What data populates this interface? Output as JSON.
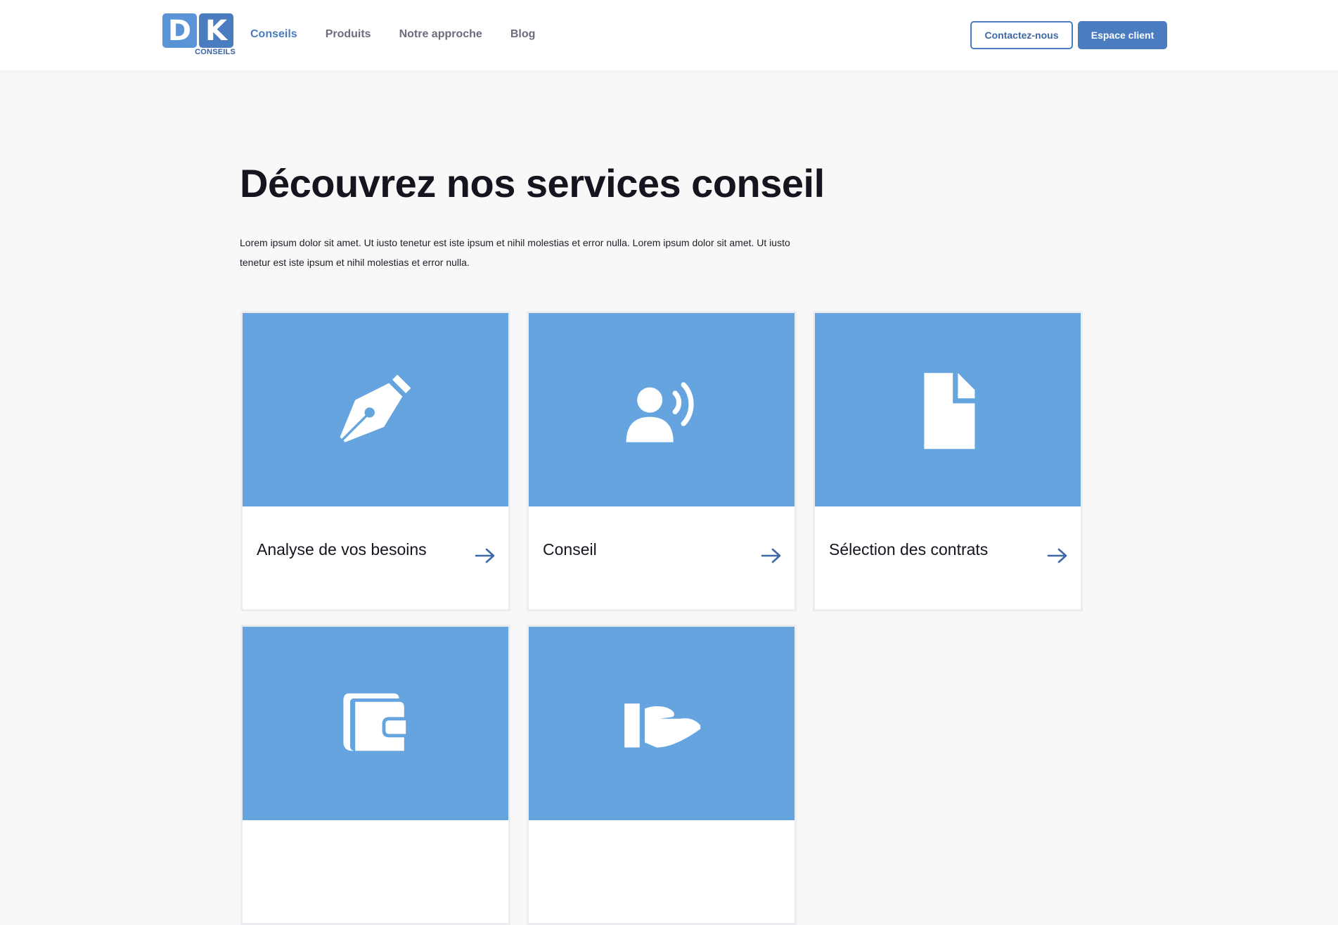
{
  "brand": {
    "letter1": "D",
    "letter2": "K",
    "subtitle": "CONSEILS",
    "color": "#4a7cc0"
  },
  "nav": {
    "items": [
      {
        "label": "Conseils",
        "active": true
      },
      {
        "label": "Produits",
        "active": false
      },
      {
        "label": "Notre approche",
        "active": false
      },
      {
        "label": "Blog",
        "active": false
      }
    ]
  },
  "header_buttons": {
    "contact": "Contactez-nous",
    "client": "Espace client"
  },
  "hero": {
    "title": "Découvrez nos services conseil",
    "intro": "Lorem ipsum dolor sit amet. Ut iusto tenetur est iste ipsum et nihil molestias et error nulla. Lorem ipsum dolor sit amet. Ut iusto tenetur est iste ipsum et nihil molestias et error nulla."
  },
  "cards": [
    {
      "label": "Analyse de vos besoins",
      "icon": "fountain-pen-icon"
    },
    {
      "label": "Conseil",
      "icon": "person-speaking-icon"
    },
    {
      "label": "Sélection des contrats",
      "icon": "document-icon"
    },
    {
      "label": "",
      "icon": "wallet-icon"
    },
    {
      "label": "",
      "icon": "hand-receiving-icon"
    }
  ],
  "colors": {
    "card_media": "#65a4de",
    "accent": "#4a7cc0",
    "background": "#f8f8f8"
  }
}
